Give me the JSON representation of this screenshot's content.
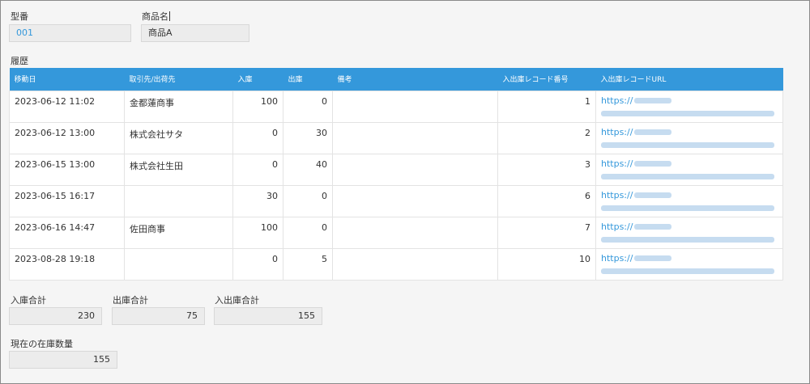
{
  "header": {
    "model_label": "型番",
    "model_value": "001",
    "product_label": "商品名",
    "product_value": "商品A"
  },
  "history": {
    "title": "履歴",
    "columns": [
      "移動日",
      "取引先/出荷先",
      "入庫",
      "出庫",
      "備考",
      "入出庫レコード番号",
      "入出庫レコードURL"
    ],
    "rows": [
      {
        "date": "2023-06-12 11:02",
        "partner": "金都蓮商事",
        "in": "100",
        "out": "0",
        "note": "",
        "record_no": "1",
        "url": "https://"
      },
      {
        "date": "2023-06-12 13:00",
        "partner": "株式会社サタ",
        "in": "0",
        "out": "30",
        "note": "",
        "record_no": "2",
        "url": "https://"
      },
      {
        "date": "2023-06-15 13:00",
        "partner": "株式会社生田",
        "in": "0",
        "out": "40",
        "note": "",
        "record_no": "3",
        "url": "https://"
      },
      {
        "date": "2023-06-15 16:17",
        "partner": "",
        "in": "30",
        "out": "0",
        "note": "",
        "record_no": "6",
        "url": "https://"
      },
      {
        "date": "2023-06-16 14:47",
        "partner": "佐田商事",
        "in": "100",
        "out": "0",
        "note": "",
        "record_no": "7",
        "url": "https://"
      },
      {
        "date": "2023-08-28 19:18",
        "partner": "",
        "in": "0",
        "out": "5",
        "note": "",
        "record_no": "10",
        "url": "https://"
      }
    ]
  },
  "totals": {
    "in_label": "入庫合計",
    "in_value": "230",
    "out_label": "出庫合計",
    "out_value": "75",
    "net_label": "入出庫合計",
    "net_value": "155"
  },
  "stock": {
    "label": "現在の在庫数量",
    "value": "155"
  },
  "colors": {
    "header_bg": "#3498db",
    "link": "#3498db"
  }
}
